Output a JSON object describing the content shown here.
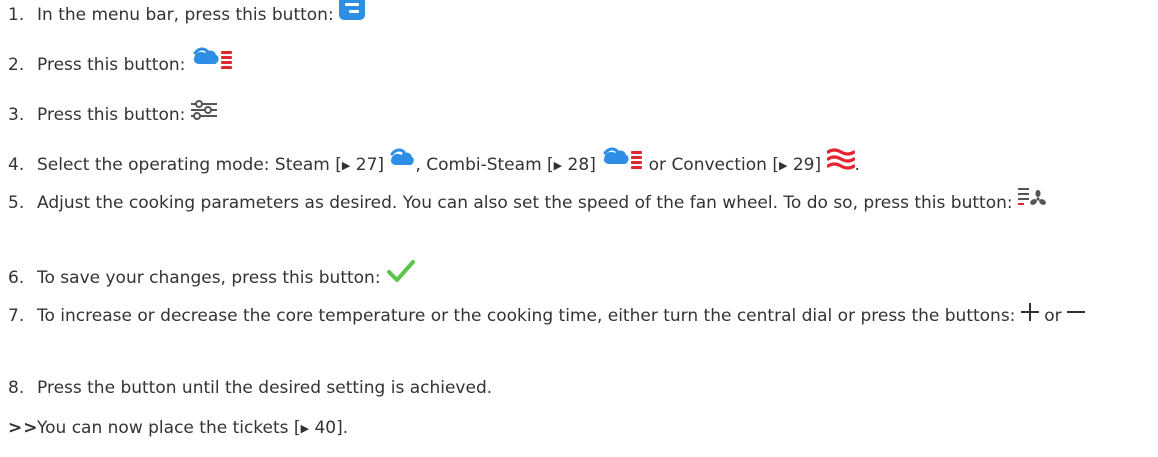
{
  "xref_marker": "▶",
  "steps": [
    {
      "num": "1.",
      "text": "In the menu bar, press this button: ",
      "icon": "menu-button-icon"
    },
    {
      "num": "2.",
      "text": "Press this button: ",
      "icon": "combi-steam-mode-icon"
    },
    {
      "num": "3.",
      "text": "Press this button:",
      "icon": "settings-sliders-icon"
    },
    {
      "num": "4.",
      "intro": "Select the operating mode: ",
      "modes": [
        {
          "name": "Steam",
          "page": "27",
          "icon": "steam-icon",
          "after": ","
        },
        {
          "name": "Combi-Steam",
          "page": "28",
          "icon": "combi-steam-icon",
          "after": " or"
        },
        {
          "name": "Convection",
          "page": "29",
          "icon": "convection-icon",
          "after": "."
        }
      ]
    },
    {
      "num": "5.",
      "text": "Adjust the cooking parameters as desired. You can also set the speed of the fan wheel. To do so, press this button:",
      "icon": "fan-speed-icon"
    },
    {
      "num": "6.",
      "text": "To save your changes, press this button: ",
      "icon": "checkmark-icon"
    },
    {
      "num": "7.",
      "text": "To increase or decrease the core temperature or the cooking time, either turn the central dial or press the buttons: ",
      "connector": " or ",
      "icons": [
        "plus-icon",
        "minus-icon"
      ]
    },
    {
      "num": "8.",
      "text": "Press the button until the desired setting is achieved."
    }
  ],
  "result": {
    "marker": ">>",
    "text": "You can now place the tickets [",
    "page": "40",
    "end": "]."
  },
  "colors": {
    "text": "#333333",
    "blue": "#2d8ee5",
    "red": "#e32530",
    "green": "#5cc44a"
  }
}
